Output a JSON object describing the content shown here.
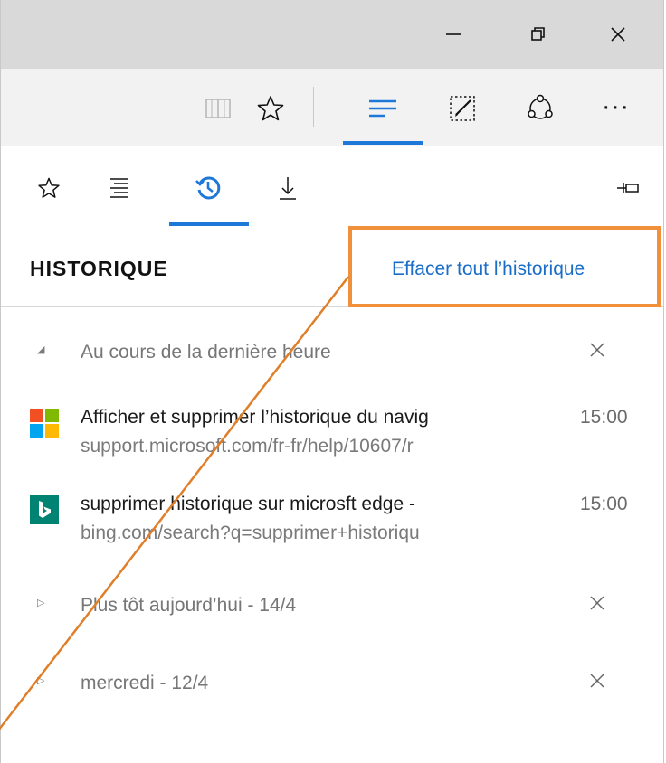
{
  "colors": {
    "accent": "#1e78d7",
    "link": "#1a6dc8",
    "highlight": "#f0903a"
  },
  "titlebar": {
    "buttons": [
      {
        "name": "minimize-icon"
      },
      {
        "name": "restore-icon"
      },
      {
        "name": "close-icon"
      }
    ]
  },
  "toolbar": {
    "icons": [
      "reading-view-icon",
      "favorite-star-icon",
      "hub-icon",
      "web-note-icon",
      "share-icon",
      "more-icon"
    ],
    "more_label": "···"
  },
  "hub_tabs": [
    "favorites-tab-icon",
    "reading-list-tab-icon",
    "history-tab-icon",
    "downloads-tab-icon",
    "pin-icon"
  ],
  "history": {
    "title": "HISTORIQUE",
    "clear_all": "Effacer tout l’historique",
    "groups": [
      {
        "label": "Au cours de la dernière heure",
        "expanded": true,
        "entries": [
          {
            "title": "Afficher et supprimer l’historique du navig",
            "url": "support.microsoft.com/fr-fr/help/10607/r",
            "time": "15:00",
            "icon": "microsoft-logo-icon"
          },
          {
            "title": "supprimer historique sur microsft edge -",
            "url": "bing.com/search?q=supprimer+historiqu",
            "time": "15:00",
            "icon": "bing-logo-icon"
          }
        ]
      },
      {
        "label": "Plus tôt aujourd’hui - 14/4",
        "expanded": false
      },
      {
        "label": "mercredi - 12/4",
        "expanded": false
      }
    ]
  }
}
